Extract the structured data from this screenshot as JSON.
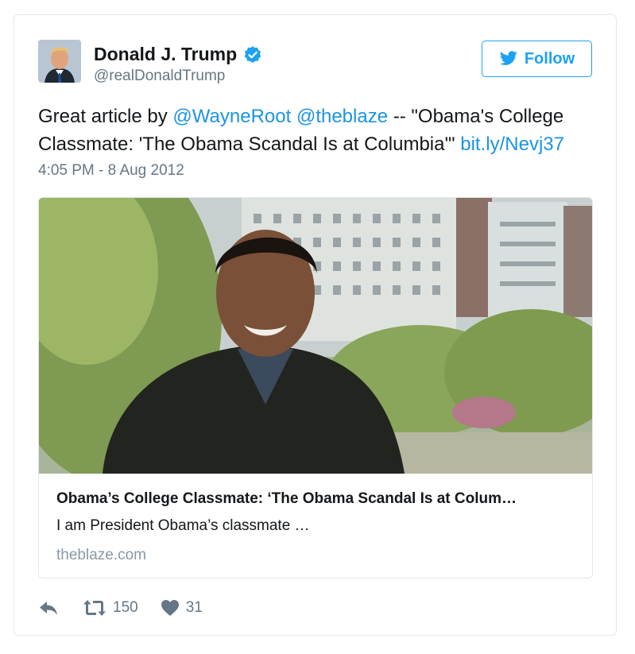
{
  "user": {
    "name": "Donald J. Trump",
    "handle": "@realDonaldTrump",
    "verified": true
  },
  "follow_label": "Follow",
  "tweet": {
    "prefix": "Great article by ",
    "mention1": "@WayneRoot",
    "space": " ",
    "mention2": "@theblaze",
    "middle": " -- \"Obama's College Classmate: 'The Obama Scandal Is at Columbia'\" ",
    "link": "bit.ly/Nevj37"
  },
  "timestamp": "4:05 PM - 8 Aug 2012",
  "card": {
    "title": "Obama’s College Classmate: ‘The Obama Scandal Is at Colum…",
    "description": "I am President Obama’s classmate …",
    "domain": "theblaze.com"
  },
  "actions": {
    "retweets": "150",
    "likes": "31"
  },
  "icons": {
    "verified": "verified-badge-icon",
    "follow": "bird-icon",
    "reply": "reply-icon",
    "retweet": "retweet-icon",
    "like": "heart-icon"
  },
  "colors": {
    "link": "#1b95e0",
    "follow": "#1da1f2",
    "muted": "#657786",
    "verified": "#1da1f2"
  }
}
